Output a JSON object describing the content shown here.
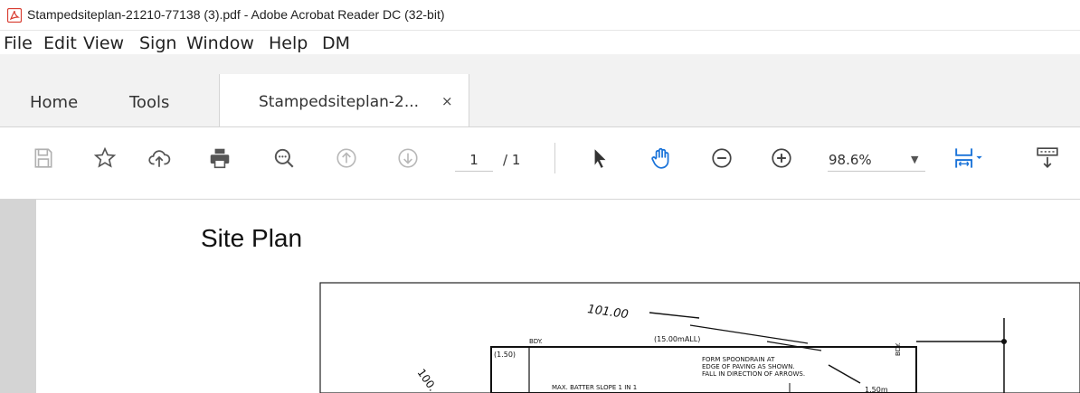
{
  "window": {
    "title": "Stampedsiteplan-21210-77138 (3).pdf - Adobe Acrobat Reader DC (32-bit)",
    "icon": "acrobat-reader-icon"
  },
  "menu": {
    "items": [
      "File",
      "Edit",
      "View",
      "Sign",
      "Window",
      "Help",
      "DM"
    ]
  },
  "tabs": {
    "home": "Home",
    "tools": "Tools",
    "document": "Stampedsiteplan-2...",
    "close": "×"
  },
  "toolbar": {
    "icons": [
      "save-icon",
      "star-icon",
      "cloud-upload-icon",
      "print-icon",
      "search-zoom-icon",
      "previous-page-icon",
      "next-page-icon",
      "select-arrow-icon",
      "hand-tool-icon",
      "zoom-out-icon",
      "zoom-in-icon",
      "fit-page-icon",
      "page-display-icon"
    ],
    "page_current": "1",
    "page_total": "/ 1",
    "zoom": "98.6%",
    "accent_color": "#1a73d9"
  },
  "document": {
    "heading": "Site Plan",
    "plan_labels": {
      "level_top": "101.00",
      "level_left": "100.",
      "bdy_left": "BDY.",
      "dimension": "(15.00mALL)",
      "corner": "(1.50)",
      "note_line1": "FORM SPOONDRAIN AT",
      "note_line2": "EDGE OF PAVING AS SHOWN.",
      "note_line3": "FALL IN DIRECTION OF ARROWS.",
      "batter": "MAX. BATTER SLOPE 1 IN 1",
      "bdy_right": "BDY.",
      "offset": "1.50m"
    }
  }
}
